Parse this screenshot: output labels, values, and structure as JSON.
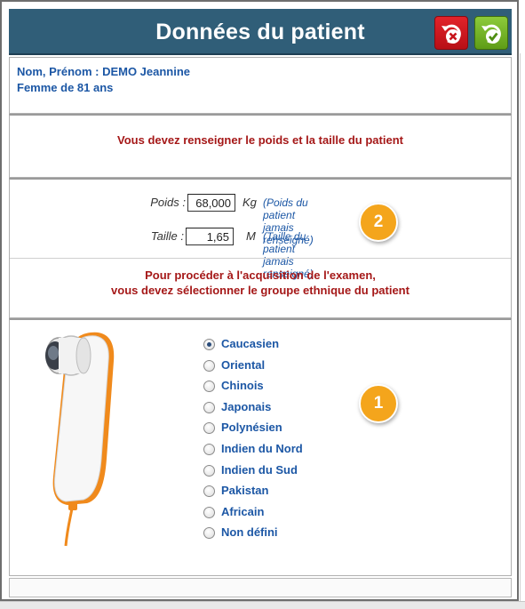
{
  "window": {
    "title": "Données du patient",
    "cancel_icon": "cancel-icon",
    "validate_icon": "validate-icon"
  },
  "patient": {
    "name_line": "Nom, Prénom : DEMO  Jeannine",
    "age_line": "Femme de  81 ans"
  },
  "notice": {
    "weight_height": "Vous devez renseigner le poids et la taille du patient"
  },
  "measures": {
    "weight_label": "Poids :",
    "weight_value": "68,000",
    "weight_unit": "Kg",
    "weight_hint": "(Poids du patient jamais renseigné)",
    "height_label": "Taille :",
    "height_value": "1,65",
    "height_unit": "M",
    "height_hint": "(Taille du patient jamais renseigné)"
  },
  "ethnic_notice": {
    "line1": "Pour procéder à l'acquisition de l'examen,",
    "line2": "vous devez sélectionner le groupe ethnique du patient"
  },
  "ethnic_groups": {
    "selected": "Caucasien",
    "options": [
      "Caucasien",
      "Oriental",
      "Chinois",
      "Japonais",
      "Polynésien",
      "Indien du Nord",
      "Indien du Sud",
      "Pakistan",
      "Africain",
      "Non défini"
    ]
  },
  "annotations": {
    "badge_1": "1",
    "badge_2": "2"
  },
  "colors": {
    "titlebar": "#305e78",
    "label_blue": "#1c57a5",
    "warning_red": "#a51818",
    "badge_orange": "#f4a51c",
    "device_orange": "#f08a1c"
  }
}
